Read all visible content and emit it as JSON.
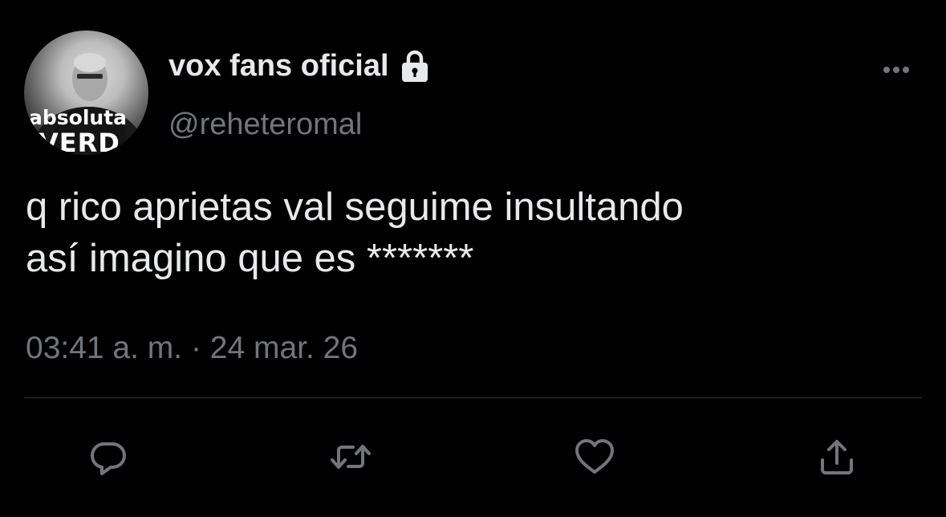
{
  "user": {
    "display_name": "vox fans oficial",
    "handle": "@reheteromal",
    "avatar_text_line1": "absoluta",
    "avatar_text_line2": "VERD",
    "protected_icon": "lock-icon"
  },
  "tweet": {
    "text_line1": "q rico aprietas val seguime insultando",
    "text_line2": "así imagino que es *******",
    "timestamp": "03:41 a. m. · 24 mar. 26"
  },
  "icons": {
    "more": "more-horizontal-icon",
    "reply": "reply-icon",
    "retweet": "retweet-icon",
    "like": "heart-icon",
    "share": "share-icon"
  },
  "colors": {
    "background": "#000000",
    "primary_text": "#e7e9ea",
    "secondary_text": "#71767b",
    "divider": "#2f3336"
  }
}
